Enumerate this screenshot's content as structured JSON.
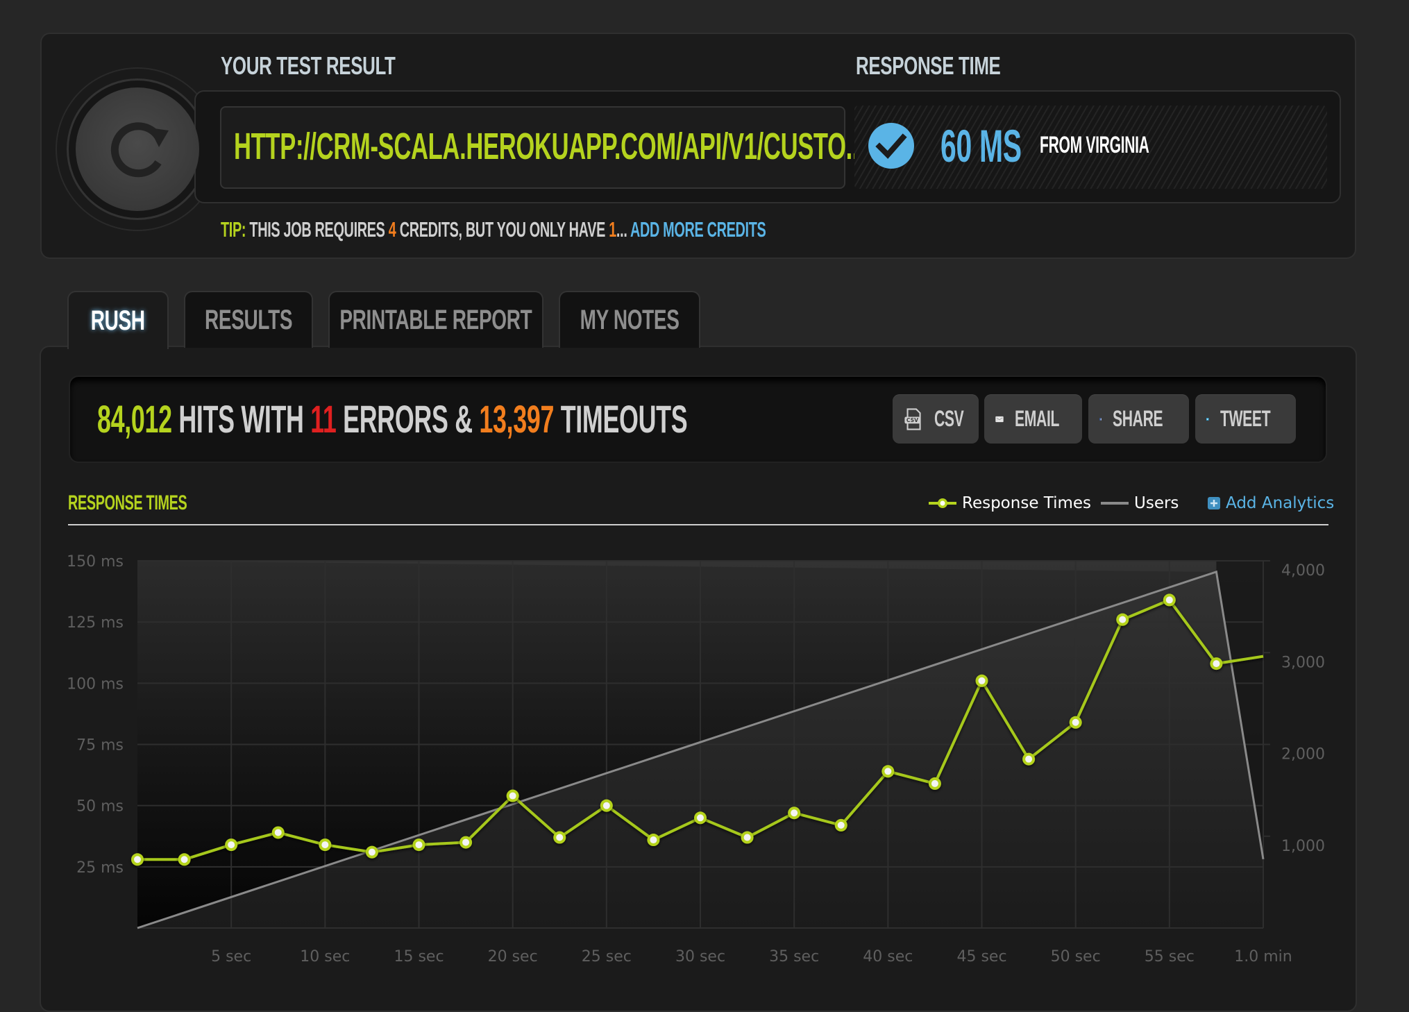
{
  "top": {
    "test_result_label": "YOUR TEST RESULT",
    "response_time_label": "RESPONSE TIME",
    "url": "HTTP://CRM-SCALA.HEROKUAPP.COM/API/V1/CUSTO...",
    "response_value": "60 MS",
    "response_from": "FROM VIRGINIA",
    "tip": {
      "prefix": "TIP:",
      "text1": " THIS JOB REQUIRES ",
      "required_credits": "4",
      "text2": " CREDITS, BUT YOU ONLY HAVE ",
      "have_credits": "1",
      "text3": "... ",
      "link": "ADD MORE CREDITS"
    }
  },
  "tabs": [
    {
      "label": "RUSH",
      "active": true
    },
    {
      "label": "RESULTS",
      "active": false
    },
    {
      "label": "PRINTABLE REPORT",
      "active": false
    },
    {
      "label": "MY NOTES",
      "active": false
    }
  ],
  "stats": {
    "hits": "84,012",
    "hits_text": " HITS WITH ",
    "errors": "11",
    "errors_text": " ERRORS & ",
    "timeouts": "13,397",
    "timeouts_text": " TIMEOUTS"
  },
  "actions": [
    {
      "label": "CSV",
      "icon": "csv-file-icon"
    },
    {
      "label": "EMAIL",
      "icon": "email-envelope-icon"
    },
    {
      "label": "SHARE",
      "icon": "facebook-icon"
    },
    {
      "label": "TWEET",
      "icon": "twitter-icon"
    }
  ],
  "chart_section": {
    "heading": "RESPONSE TIMES",
    "legend": [
      {
        "label": "Response Times"
      },
      {
        "label": "Users"
      }
    ],
    "add_analytics": "Add Analytics"
  },
  "colors": {
    "accent_lime": "#b5d31e",
    "accent_orange": "#f27e1e",
    "accent_blue": "#5ab4e6",
    "error_red": "#e02020",
    "users_line": "#8a8a8a"
  },
  "chart_data": {
    "type": "line",
    "title": "RESPONSE TIMES",
    "xlabel": "",
    "ylabel": "",
    "x_unit": "sec",
    "xlim": [
      0,
      60
    ],
    "x_ticks": [
      5,
      10,
      15,
      20,
      25,
      30,
      35,
      40,
      45,
      50,
      55,
      60
    ],
    "x_tick_labels": [
      "5 sec",
      "10 sec",
      "15 sec",
      "20 sec",
      "25 sec",
      "30 sec",
      "35 sec",
      "40 sec",
      "45 sec",
      "50 sec",
      "55 sec",
      "1.0 min"
    ],
    "y_left": {
      "range": [
        0,
        150
      ],
      "ticks": [
        25,
        50,
        75,
        100,
        125,
        150
      ],
      "tick_labels": [
        "25 ms",
        "50 ms",
        "75 ms",
        "100 ms",
        "125 ms",
        "150 ms"
      ]
    },
    "y_right": {
      "range": [
        0,
        4000
      ],
      "ticks": [
        1000,
        2000,
        3000,
        4000
      ],
      "tick_labels": [
        "1,000",
        "2,000",
        "3,000",
        "4,000"
      ]
    },
    "grid": true,
    "legend_position": "top-right",
    "series": [
      {
        "name": "Response Times",
        "axis": "left",
        "markers": true,
        "x": [
          0,
          2.5,
          5,
          7.5,
          10,
          12.5,
          15,
          17.5,
          20,
          22.5,
          25,
          27.5,
          30,
          32.5,
          35,
          37.5,
          40,
          42.5,
          45,
          47.5,
          50,
          52.5,
          55,
          57.5,
          60
        ],
        "values": [
          28,
          28,
          34,
          39,
          34,
          31,
          34,
          35,
          54,
          37,
          50,
          36,
          45,
          37,
          47,
          42,
          64,
          59,
          101,
          69,
          84,
          126,
          134,
          108,
          111
        ],
        "marker_until_index": 23
      },
      {
        "name": "Users",
        "axis": "right",
        "markers": false,
        "x": [
          0,
          57.5,
          60
        ],
        "values": [
          0,
          3880,
          750
        ]
      }
    ]
  }
}
